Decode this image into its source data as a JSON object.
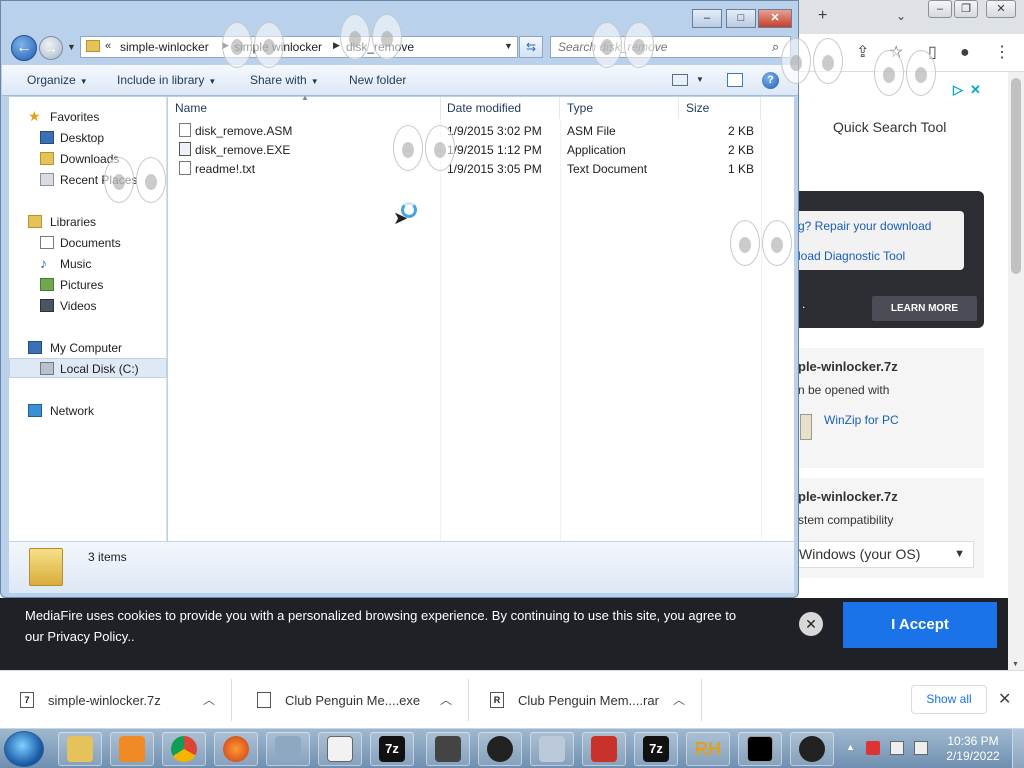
{
  "explorer": {
    "breadcrumb": [
      "simple-winlocker",
      "simple winlocker",
      "disk_remove"
    ],
    "search_placeholder": "Search disk_remove",
    "commands": {
      "organize": "Organize",
      "include_in_library": "Include in library",
      "share_with": "Share with",
      "new_folder": "New folder"
    },
    "nav": {
      "favorites": "Favorites",
      "desktop": "Desktop",
      "downloads": "Downloads",
      "recent_places": "Recent Places",
      "libraries": "Libraries",
      "documents": "Documents",
      "music": "Music",
      "pictures": "Pictures",
      "videos": "Videos",
      "my_computer": "My Computer",
      "local_disk": "Local Disk (C:)",
      "network": "Network"
    },
    "columns": {
      "name": "Name",
      "date_modified": "Date modified",
      "type": "Type",
      "size": "Size"
    },
    "files": [
      {
        "name": "disk_remove.ASM",
        "date": "1/9/2015 3:02 PM",
        "type": "ASM File",
        "size": "2 KB"
      },
      {
        "name": "disk_remove.EXE",
        "date": "1/9/2015 1:12 PM",
        "type": "Application",
        "size": "2 KB"
      },
      {
        "name": "readme!.txt",
        "date": "1/9/2015 3:05 PM",
        "type": "Text Document",
        "size": "1 KB"
      }
    ],
    "status": "3 items"
  },
  "browser": {
    "quick_search_title": "Quick Search Tool",
    "repair_link": "g? Repair your download",
    "diag_link": "load Diagnostic Tool",
    "dark_text": ".",
    "learn_more": "LEARN MORE",
    "card1": {
      "title": "ple-winlocker.7z",
      "line1": "n be opened with",
      "winzip": "WinZip for PC"
    },
    "card2": {
      "title": "ple-winlocker.7z",
      "line1": "stem compatibility",
      "os_select": "Windows (your OS)"
    },
    "cookie": {
      "text": "MediaFire uses cookies to provide you with a personalized browsing experience. By continuing to use this site, you agree to our Privacy Policy..",
      "accept": "I Accept"
    },
    "downloads": [
      {
        "name": "simple-winlocker.7z"
      },
      {
        "name": "Club Penguin Me....exe"
      },
      {
        "name": "Club Penguin Mem....rar"
      }
    ],
    "show_all": "Show all"
  },
  "taskbar": {
    "time": "10:36 PM",
    "date": "2/19/2022",
    "apps": [
      "7z",
      "7z",
      "RH"
    ]
  },
  "colors": {
    "accept_blue": "#1a73e8",
    "explorer_frame": "#b9d1ea",
    "cookie_bg": "#1f2126"
  }
}
